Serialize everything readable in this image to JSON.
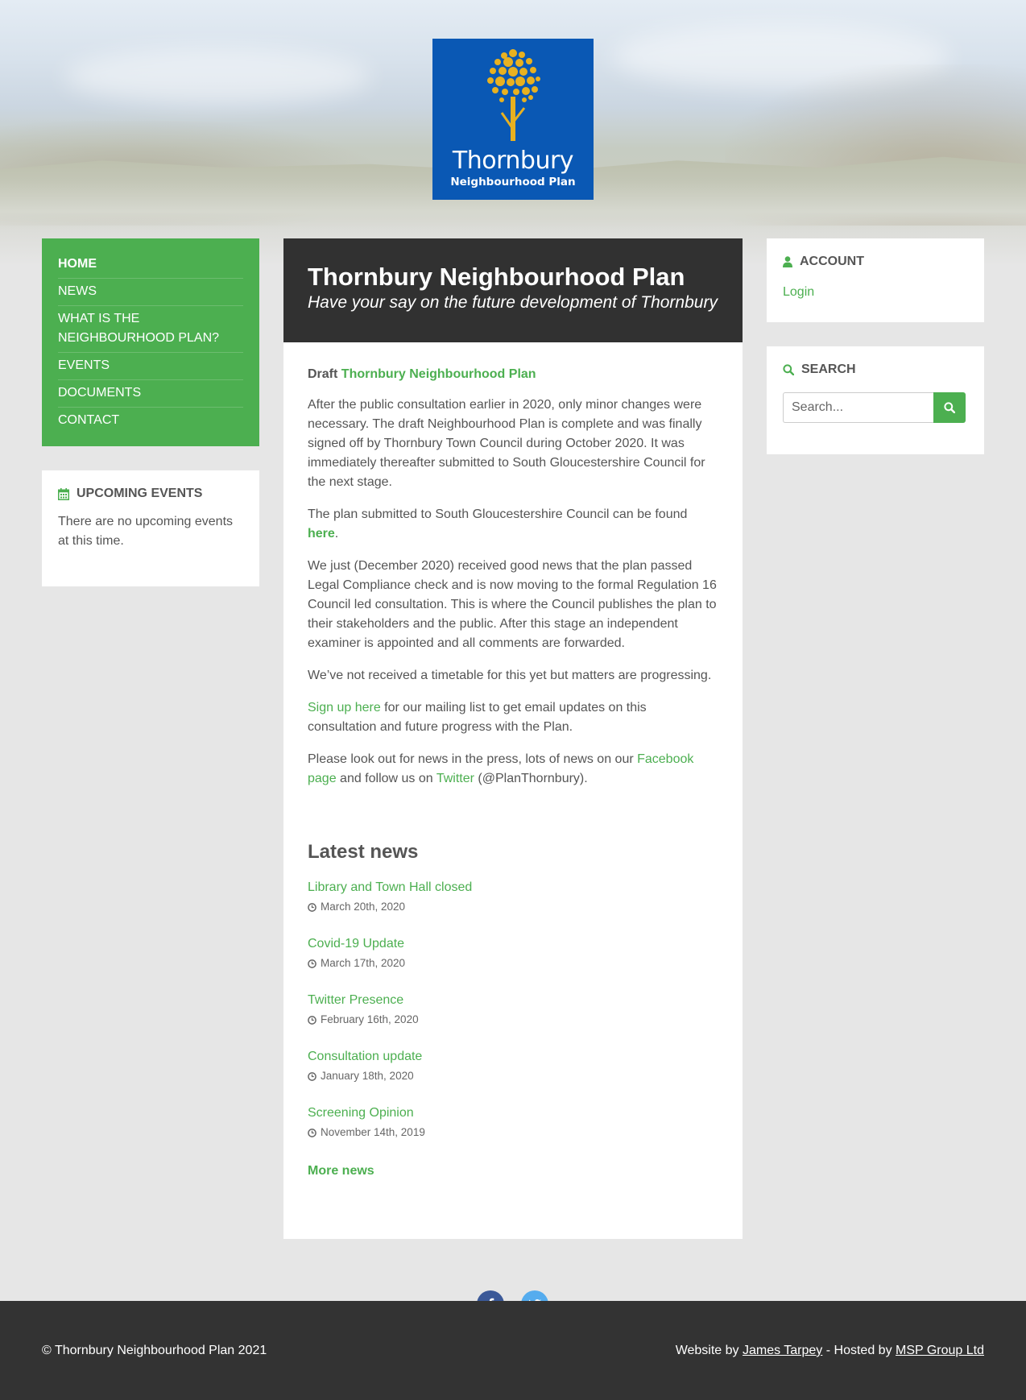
{
  "logo": {
    "name": "Thornbury",
    "sub": "Neighbourhood Plan"
  },
  "nav": [
    {
      "label": "HOME"
    },
    {
      "label": "NEWS"
    },
    {
      "label": "WHAT IS THE NEIGHBOURHOOD PLAN?"
    },
    {
      "label": "EVENTS"
    },
    {
      "label": "DOCUMENTS"
    },
    {
      "label": "CONTACT"
    }
  ],
  "events": {
    "title": "UPCOMING EVENTS",
    "text": "There are no upcoming events at this time."
  },
  "main": {
    "title": "Thornbury Neighbourhood Plan",
    "subtitle": "Have your say on the future development of Thornbury",
    "draft_prefix": "Draft",
    "draft_link": "Thornbury Neighbourhood Plan",
    "p1": "After the public consultation earlier in 2020, only minor changes were necessary. The draft Neighbourhood Plan is complete and was finally signed off by Thornbury Town Council during October 2020. It was immediately thereafter submitted to South Gloucestershire Council for the next stage.",
    "p2_text": "The plan submitted to South Gloucestershire Council can be found",
    "p2_link": "here",
    "p2_end": ".",
    "p3": "We just (December 2020) received good news that the plan passed Legal Compliance check and is now moving to the formal Regulation 16 Council led consultation. This is where the Council publishes the plan to their stakeholders and the public. After this stage an independent examiner is appointed and all comments are forwarded.",
    "p4": "We’ve not received a timetable for this yet but matters are progressing.",
    "p5_link": "Sign up here",
    "p5_text": " for our mailing list to get email updates on this consultation and future progress with the Plan.",
    "p6_a": "Please look out for news in the press, lots of news on our ",
    "p6_fb": "Facebook page",
    "p6_b": " and follow us on ",
    "p6_tw": "Twitter",
    "p6_c": " (@PlanThornbury).",
    "latest_title": "Latest news",
    "news": [
      {
        "title": "Library and Town Hall closed",
        "date": "March 20th, 2020"
      },
      {
        "title": "Covid-19 Update",
        "date": "March 17th, 2020"
      },
      {
        "title": "Twitter Presence",
        "date": "February 16th, 2020"
      },
      {
        "title": "Consultation update",
        "date": "January 18th, 2020"
      },
      {
        "title": "Screening Opinion",
        "date": "November 14th, 2019"
      }
    ],
    "more_news": "More news"
  },
  "account": {
    "title": "ACCOUNT",
    "login": "Login"
  },
  "search": {
    "title": "SEARCH",
    "placeholder": "Search..."
  },
  "footer": {
    "copyright": "© Thornbury Neighbourhood Plan 2021",
    "website_by": "Website by",
    "author": "James Tarpey",
    "hosted_by": " - Hosted by ",
    "host": "MSP Group Ltd"
  },
  "colors": {
    "accent": "#4caf50",
    "header_dark": "#313131",
    "logo_blue": "#0a58b4",
    "logo_gold": "#e8b121",
    "facebook": "#3b5998",
    "twitter": "#55acee"
  },
  "icons": [
    "user-icon",
    "calendar-icon",
    "search-icon",
    "clock-icon",
    "facebook-icon",
    "twitter-icon"
  ]
}
